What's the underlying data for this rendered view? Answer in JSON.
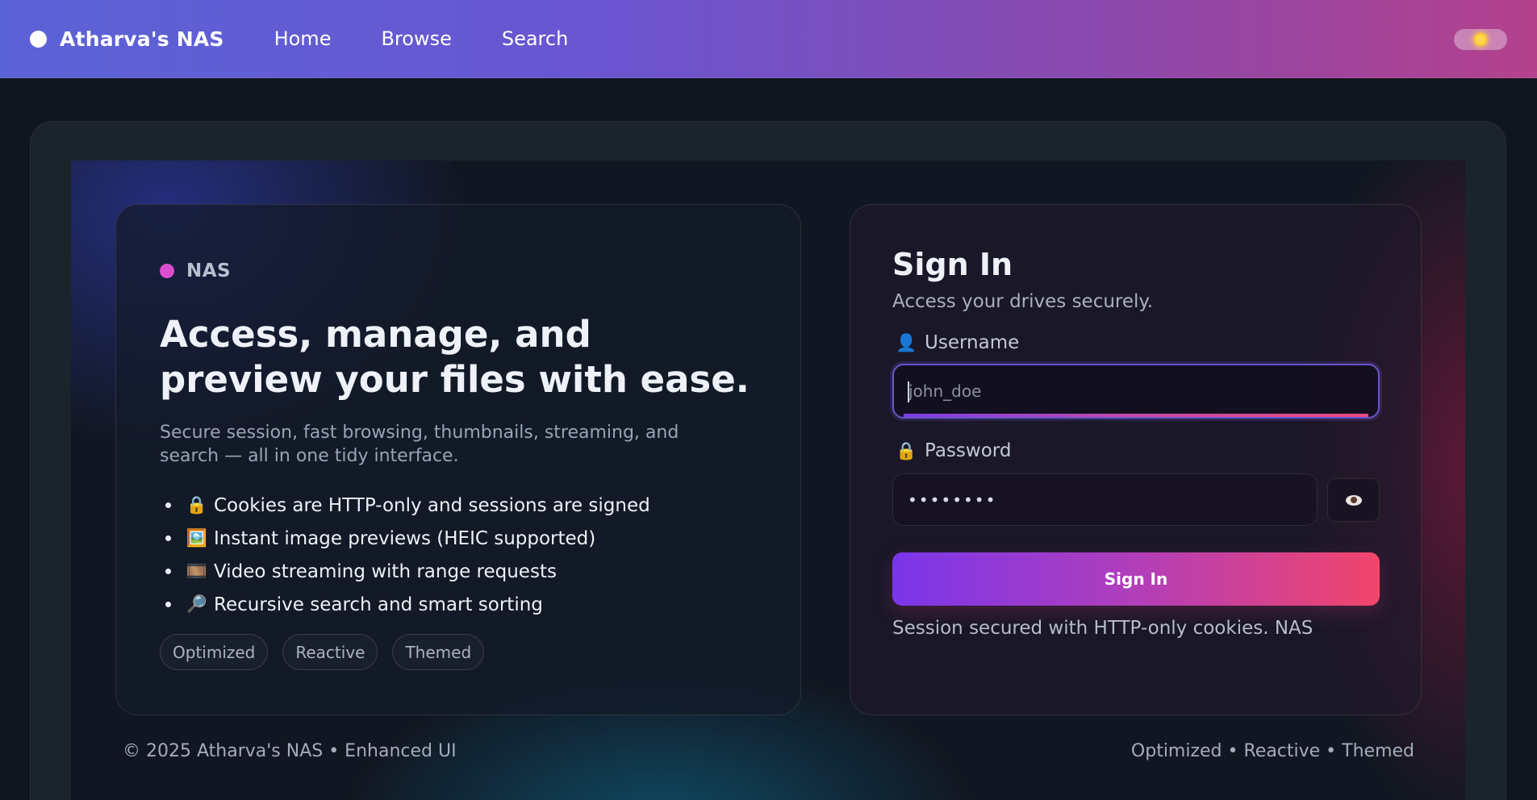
{
  "topbar": {
    "brand": "Atharva's NAS",
    "nav": [
      "Home",
      "Browse",
      "Search"
    ],
    "theme_icon": "sun-icon"
  },
  "hero": {
    "tag": "NAS",
    "headline": "Access, manage, and preview your files with ease.",
    "subtext": "Secure session, fast browsing, thumbnails, streaming, and search — all in one tidy interface.",
    "features": [
      {
        "icon": "🔒",
        "icon_name": "lock-icon",
        "text": "Cookies are HTTP-only and sessions are signed"
      },
      {
        "icon": "🖼️",
        "icon_name": "image-icon",
        "text": "Instant image previews (HEIC supported)"
      },
      {
        "icon": "🎞️",
        "icon_name": "film-icon",
        "text": "Video streaming with range requests"
      },
      {
        "icon": "🔎",
        "icon_name": "magnifier-icon",
        "text": "Recursive search and smart sorting"
      }
    ],
    "chips": [
      "Optimized",
      "Reactive",
      "Themed"
    ]
  },
  "signin": {
    "title": "Sign In",
    "subtitle": "Access your drives securely.",
    "username_label": "Username",
    "username_icon": "👤",
    "username_placeholder": "john_doe",
    "username_value": "",
    "password_label": "Password",
    "password_icon": "🔒",
    "password_value": "••••••••",
    "toggle_icon": "eye-icon",
    "button": "Sign In",
    "note": "Session secured with HTTP-only cookies. NAS"
  },
  "footer": {
    "left": "© 2025 Atharva's NAS • Enhanced UI",
    "right": "Optimized • Reactive • Themed"
  },
  "colors": {
    "accent_purple": "#7a36ea",
    "accent_pink": "#f2456a",
    "tag_dot": "#d94fd0",
    "background": "#0f161d"
  }
}
